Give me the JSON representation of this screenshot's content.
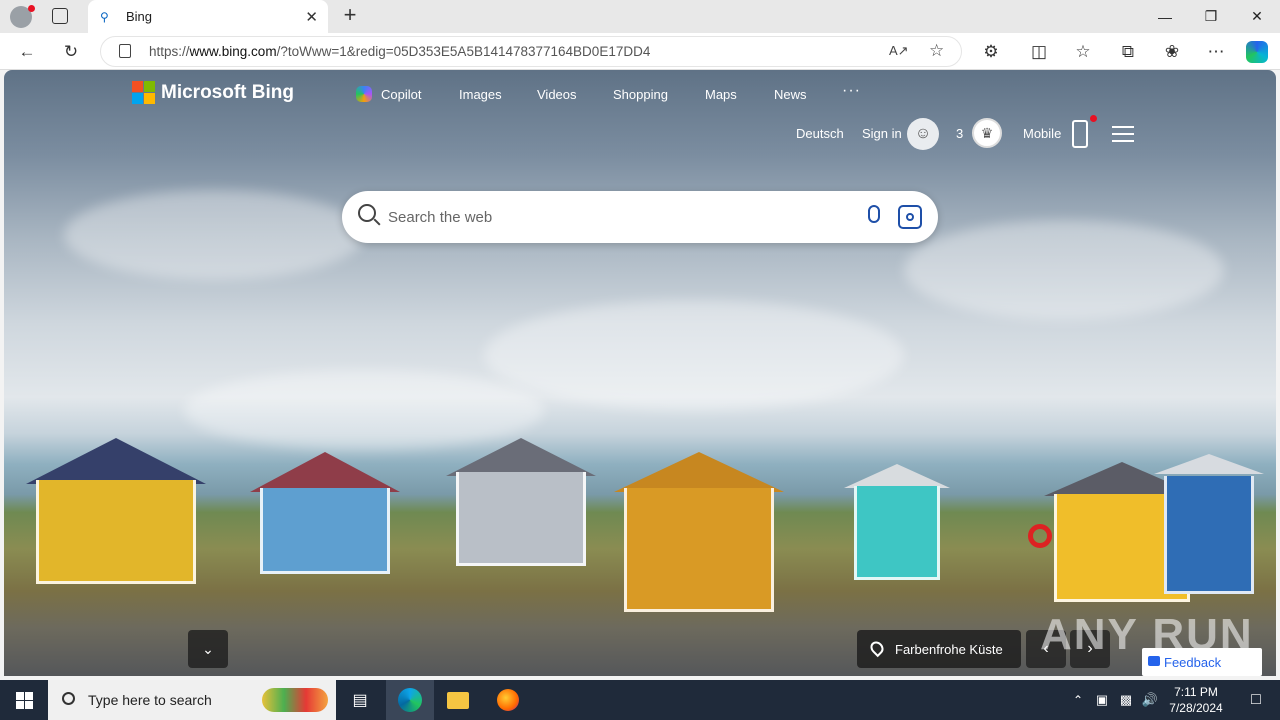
{
  "browser": {
    "tab_title": "Bing",
    "url_prefix": "https://",
    "url_domain": "www.bing.com",
    "url_rest": "/?toWww=1&redig=05D353E5A5B141478377164BD0E17DD4"
  },
  "bing": {
    "brand": "Microsoft Bing",
    "nav": [
      "Copilot",
      "Images",
      "Videos",
      "Shopping",
      "Maps",
      "News",
      "···"
    ],
    "language_link": "Deutsch",
    "sign_in": "Sign in",
    "rewards_count": "3",
    "mobile_label": "Mobile",
    "search_placeholder": "Search the web",
    "image_location": "Farbenfrohe Küste",
    "feedback_label": "Feedback",
    "colors": {
      "accent": "#0a66c2",
      "notify_dot": "#e81123"
    }
  },
  "watermark": "ANY RUN",
  "taskbar": {
    "search_placeholder": "Type here to search",
    "time": "7:11 PM",
    "date": "7/28/2024"
  }
}
